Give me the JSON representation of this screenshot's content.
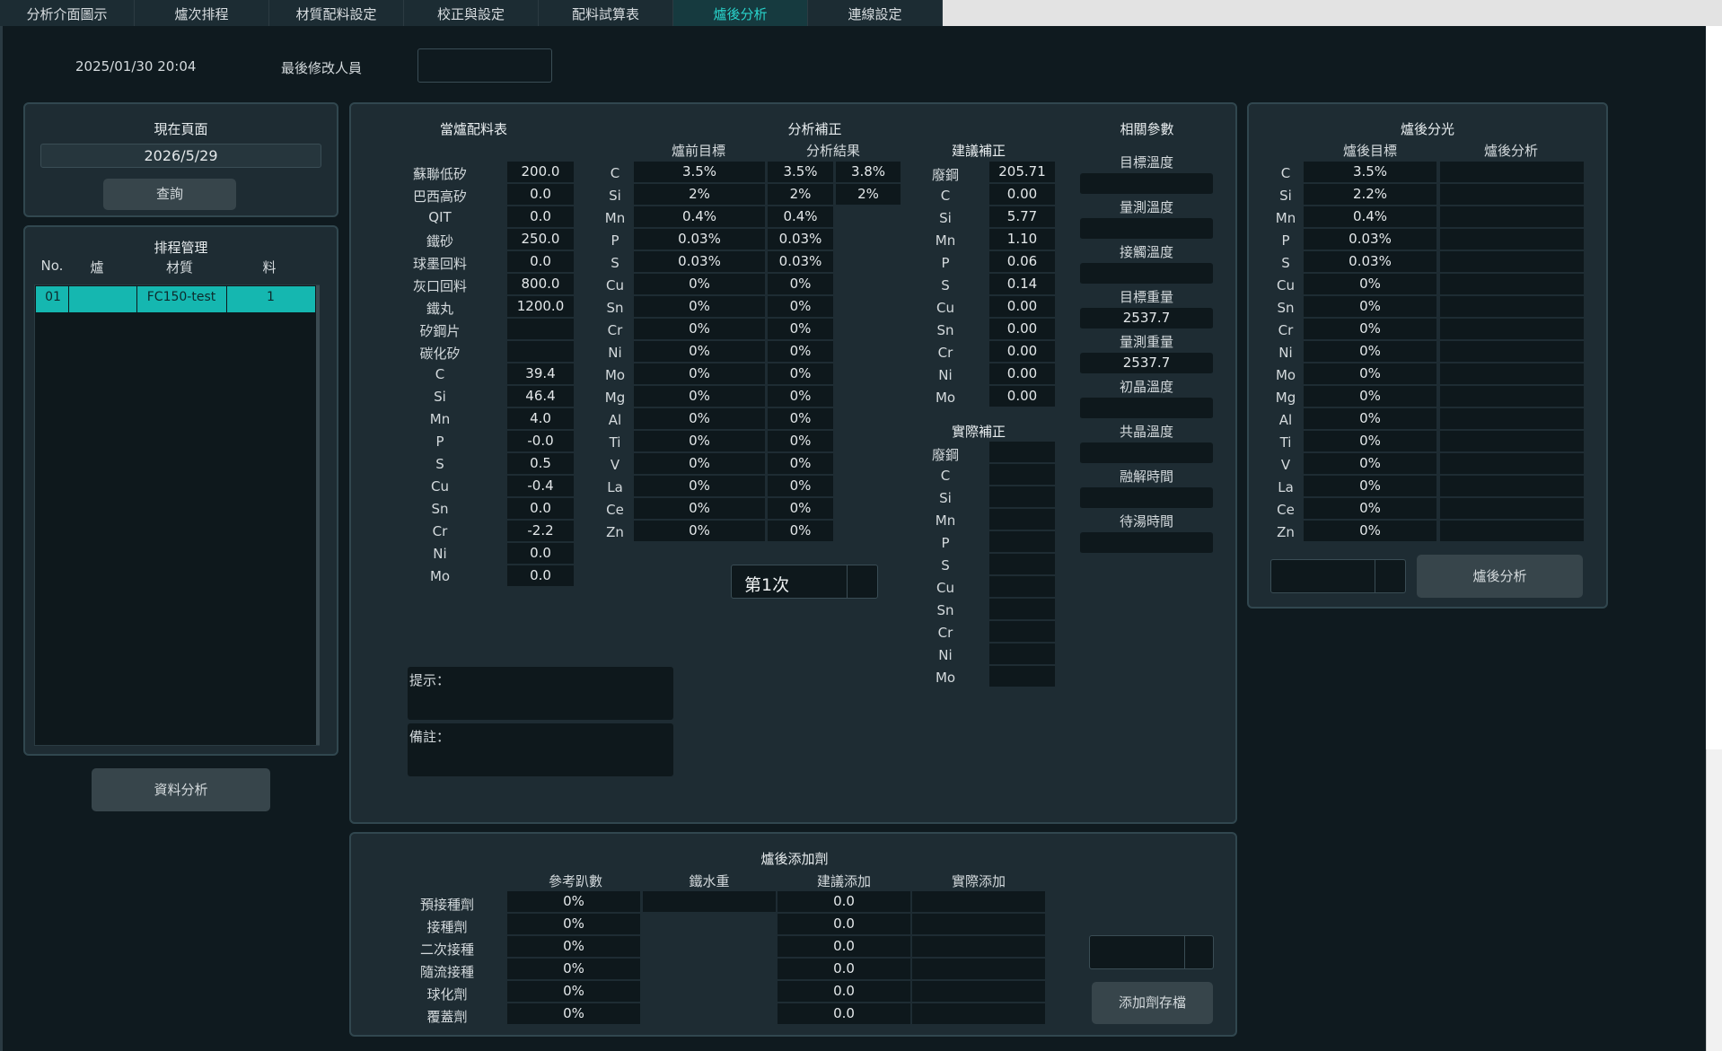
{
  "tabs": [
    "分析介面圖示",
    "爐次排程",
    "材質配料設定",
    "校正與設定",
    "配料試算表",
    "爐後分析",
    "連線設定"
  ],
  "active_tab": "爐後分析",
  "header": {
    "datetime": "2025/01/30 20:04",
    "modifier_label": "最後修改人員",
    "modifier_value": ""
  },
  "current_page": {
    "title": "現在頁面",
    "date": "2026/5/29",
    "query_button": "查詢"
  },
  "schedule": {
    "title": "排程管理",
    "columns": [
      "No.",
      "爐",
      "材質",
      "料"
    ],
    "rows": [
      {
        "no": "01",
        "furnace": "",
        "material": "FC150-test",
        "charge": "1"
      }
    ]
  },
  "data_analysis_button": "資料分析",
  "charge_table": {
    "title": "當爐配料表",
    "materials": [
      {
        "name": "蘇聯低矽",
        "value": "200.0"
      },
      {
        "name": "巴西高矽",
        "value": "0.0"
      },
      {
        "name": "QIT",
        "value": "0.0"
      },
      {
        "name": "鐵砂",
        "value": "250.0"
      },
      {
        "name": "球墨回料",
        "value": "0.0"
      },
      {
        "name": "灰口回料",
        "value": "800.0"
      },
      {
        "name": "鐵丸",
        "value": "1200.0"
      },
      {
        "name": "矽鋼片",
        "value": ""
      },
      {
        "name": "碳化矽",
        "value": ""
      }
    ],
    "elements": [
      {
        "name": "C",
        "value": "39.4"
      },
      {
        "name": "Si",
        "value": "46.4"
      },
      {
        "name": "Mn",
        "value": "4.0"
      },
      {
        "name": "P",
        "value": "-0.0"
      },
      {
        "name": "S",
        "value": "0.5"
      },
      {
        "name": "Cu",
        "value": "-0.4"
      },
      {
        "name": "Sn",
        "value": "0.0"
      },
      {
        "name": "Cr",
        "value": "-2.2"
      },
      {
        "name": "Ni",
        "value": "0.0"
      },
      {
        "name": "Mo",
        "value": "0.0"
      }
    ]
  },
  "analysis_correction": {
    "title": "分析補正",
    "col_pre_target": "爐前目標",
    "col_result": "分析結果",
    "rows": [
      {
        "el": "C",
        "target": "3.5%",
        "r1": "3.5%",
        "r2": "3.8%"
      },
      {
        "el": "Si",
        "target": "2%",
        "r1": "2%",
        "r2": "2%"
      },
      {
        "el": "Mn",
        "target": "0.4%",
        "r1": "0.4%"
      },
      {
        "el": "P",
        "target": "0.03%",
        "r1": "0.03%"
      },
      {
        "el": "S",
        "target": "0.03%",
        "r1": "0.03%"
      },
      {
        "el": "Cu",
        "target": "0%",
        "r1": "0%"
      },
      {
        "el": "Sn",
        "target": "0%",
        "r1": "0%"
      },
      {
        "el": "Cr",
        "target": "0%",
        "r1": "0%"
      },
      {
        "el": "Ni",
        "target": "0%",
        "r1": "0%"
      },
      {
        "el": "Mo",
        "target": "0%",
        "r1": "0%"
      },
      {
        "el": "Mg",
        "target": "0%",
        "r1": "0%"
      },
      {
        "el": "Al",
        "target": "0%",
        "r1": "0%"
      },
      {
        "el": "Ti",
        "target": "0%",
        "r1": "0%"
      },
      {
        "el": "V",
        "target": "0%",
        "r1": "0%"
      },
      {
        "el": "La",
        "target": "0%",
        "r1": "0%"
      },
      {
        "el": "Ce",
        "target": "0%",
        "r1": "0%"
      },
      {
        "el": "Zn",
        "target": "0%",
        "r1": "0%"
      }
    ],
    "round_select": "第1次"
  },
  "suggested_correction": {
    "title": "建議補正",
    "rows": [
      {
        "el": "廢鋼",
        "val": "205.71"
      },
      {
        "el": "C",
        "val": "0.00"
      },
      {
        "el": "Si",
        "val": "5.77"
      },
      {
        "el": "Mn",
        "val": "1.10"
      },
      {
        "el": "P",
        "val": "0.06"
      },
      {
        "el": "S",
        "val": "0.14"
      },
      {
        "el": "Cu",
        "val": "0.00"
      },
      {
        "el": "Sn",
        "val": "0.00"
      },
      {
        "el": "Cr",
        "val": "0.00"
      },
      {
        "el": "Ni",
        "val": "0.00"
      },
      {
        "el": "Mo",
        "val": "0.00"
      }
    ]
  },
  "actual_correction": {
    "title": "實際補正",
    "rows": [
      "廢鋼",
      "C",
      "Si",
      "Mn",
      "P",
      "S",
      "Cu",
      "Sn",
      "Cr",
      "Ni",
      "Mo"
    ]
  },
  "params": {
    "title": "相關參數",
    "items": [
      {
        "label": "目標溫度",
        "value": ""
      },
      {
        "label": "量測溫度",
        "value": ""
      },
      {
        "label": "接觸溫度",
        "value": ""
      },
      {
        "label": "目標重量",
        "value": "2537.7"
      },
      {
        "label": "量測重量",
        "value": "2537.7"
      },
      {
        "label": "初晶溫度",
        "value": ""
      },
      {
        "label": "共晶溫度",
        "value": ""
      },
      {
        "label": "融解時間",
        "value": ""
      },
      {
        "label": "待湯時間",
        "value": ""
      }
    ]
  },
  "notes": {
    "hint_label": "提示：",
    "remark_label": "備註："
  },
  "spectro": {
    "title": "爐後分光",
    "col_target": "爐後目標",
    "col_analysis": "爐後分析",
    "rows": [
      {
        "el": "C",
        "target": "3.5%"
      },
      {
        "el": "Si",
        "target": "2.2%"
      },
      {
        "el": "Mn",
        "target": "0.4%"
      },
      {
        "el": "P",
        "target": "0.03%"
      },
      {
        "el": "S",
        "target": "0.03%"
      },
      {
        "el": "Cu",
        "target": "0%"
      },
      {
        "el": "Sn",
        "target": "0%"
      },
      {
        "el": "Cr",
        "target": "0%"
      },
      {
        "el": "Ni",
        "target": "0%"
      },
      {
        "el": "Mo",
        "target": "0%"
      },
      {
        "el": "Mg",
        "target": "0%"
      },
      {
        "el": "Al",
        "target": "0%"
      },
      {
        "el": "Ti",
        "target": "0%"
      },
      {
        "el": "V",
        "target": "0%"
      },
      {
        "el": "La",
        "target": "0%"
      },
      {
        "el": "Ce",
        "target": "0%"
      },
      {
        "el": "Zn",
        "target": "0%"
      }
    ],
    "button": "爐後分析"
  },
  "additives": {
    "title": "爐後添加劑",
    "columns": [
      "參考趴數",
      "鐵水重",
      "建議添加",
      "實際添加"
    ],
    "rows": [
      {
        "name": "預接種劑",
        "ref": "0%",
        "suggest": "0.0"
      },
      {
        "name": "接種劑",
        "ref": "0%",
        "suggest": "0.0"
      },
      {
        "name": "二次接種",
        "ref": "0%",
        "suggest": "0.0"
      },
      {
        "name": "隨流接種",
        "ref": "0%",
        "suggest": "0.0"
      },
      {
        "name": "球化劑",
        "ref": "0%",
        "suggest": "0.0"
      },
      {
        "name": "覆蓋劑",
        "ref": "0%",
        "suggest": "0.0"
      }
    ],
    "button": "添加劑存檔"
  }
}
